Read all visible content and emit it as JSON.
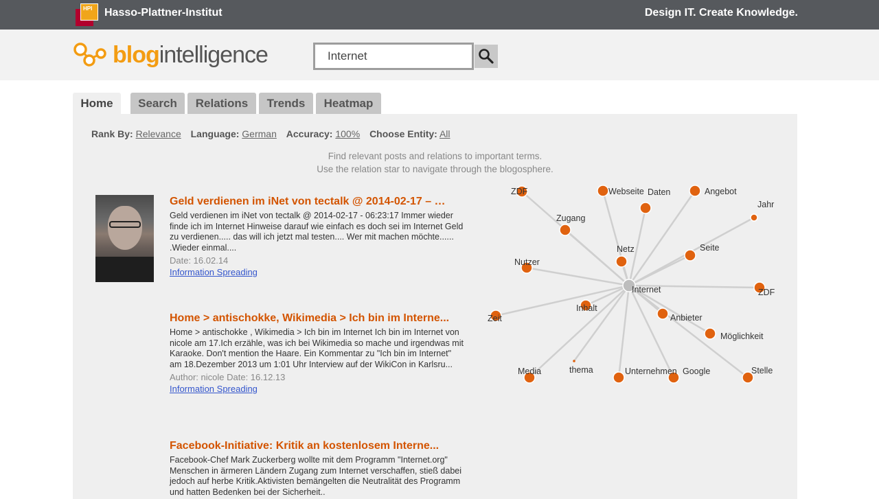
{
  "topbar": {
    "logo_text": "HPI",
    "institute": "Hasso-Plattner-Institut",
    "slogan": "Design IT. Create Knowledge."
  },
  "header": {
    "logo_blog": "blog",
    "logo_intelligence": "intelligence",
    "search_value": "Internet",
    "search_icon": "search-icon"
  },
  "tabs": [
    {
      "label": "Home",
      "active": true
    },
    {
      "label": "Search",
      "active": false
    },
    {
      "label": "Relations",
      "active": false
    },
    {
      "label": "Trends",
      "active": false
    },
    {
      "label": "Heatmap",
      "active": false
    }
  ],
  "filters": {
    "rank_label": "Rank By:",
    "rank_value": "Relevance",
    "language_label": "Language:",
    "language_value": "German",
    "accuracy_label": "Accuracy:",
    "accuracy_value": "100%",
    "entity_label": "Choose Entity:",
    "entity_value": "All"
  },
  "intro": {
    "line1": "Find relevant posts and relations to important terms.",
    "line2": "Use the relation star to navigate through the blogosphere."
  },
  "posts": [
    {
      "title": "Geld verdienen im iNet von tectalk @ 2014-02-17 – …",
      "body": "Geld verdienen im iNet von tectalk @ 2014-02-17 - 06:23:17 Immer wieder finde ich im Internet Hinweise darauf wie einfach es doch sei im Internet Geld zu verdienen..... das will ich jetzt mal testen.... Wer mit machen möchte...... .Wieder einmal....",
      "meta": "Date: 16.02.14",
      "link": "Information Spreading"
    },
    {
      "title": "Home > antischokke, Wikimedia > Ich bin im Interne...",
      "body": "Home > antischokke , Wikimedia > Ich bin im Internet     Ich bin im Internet von nicole am 17.Ich erzähle, was ich bei Wikimedia so mache und irgendwas mit Karaoke. Don't mention the Haare. Ein Kommentar zu \"Ich bin im Internet\" am 18.Dezember 2013 um 1:01 Uhr Interview auf der WikiCon in Karlsru...",
      "meta": "Author: nicole Date: 16.12.13",
      "link": "Information Spreading"
    },
    {
      "title": "Facebook-Initiative: Kritik an kostenlosem Interne...",
      "body": "Facebook-Chef Mark Zuckerberg wollte mit dem Programm \"Internet.org\" Menschen in ärmeren Ländern Zugang zum Internet verschaffen, stieß dabei jedoch auf herbe Kritik.Aktivisten bemängelten die Neutralität des Programm und hatten Bedenken bei der Sicherheit..",
      "meta": "",
      "link": ""
    }
  ],
  "relation_star": {
    "center": "Internet",
    "terms": [
      "ZDF",
      "Webseite",
      "Daten",
      "Angebot",
      "Jahr",
      "Zugang",
      "Netz",
      "Seite",
      "Nutzer",
      "ZDF",
      "Inhalt",
      "Anbieter",
      "Zeit",
      "Möglichkeit",
      "Media",
      "thema",
      "Unternehmen",
      "Google",
      "Stelle"
    ],
    "colors": {
      "node": "#e0620f",
      "center": "#bdbdbd",
      "edge": "#cfcfcf"
    }
  }
}
